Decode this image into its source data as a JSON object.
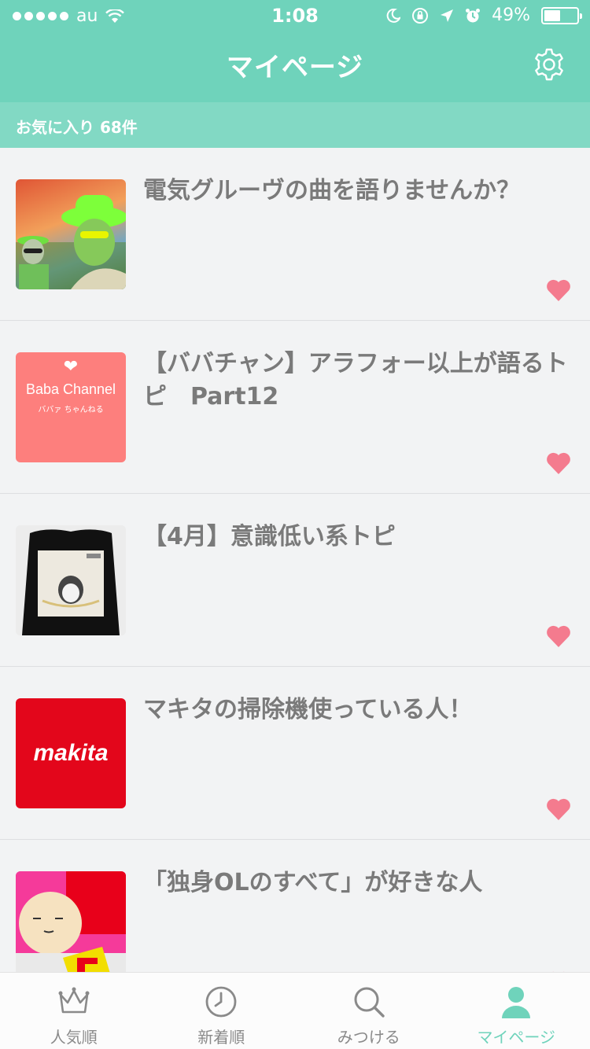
{
  "status_bar": {
    "carrier": "au",
    "time": "1:08",
    "battery_text": "49%",
    "battery_level": 0.49
  },
  "header": {
    "title": "マイページ",
    "settings_icon": "gear-icon"
  },
  "favorites": {
    "label": "お気に入り 68件"
  },
  "items": [
    {
      "title": "電気グルーヴの曲を語りませんか？",
      "favorited": true
    },
    {
      "title": "【ババチャン】アラフォー以上が語るトピ　Part12",
      "favorited": true,
      "thumb": {
        "heart": "❤",
        "name": "Baba Channel",
        "sub": "ババァ ちゃんねる"
      }
    },
    {
      "title": "【4月】意識低い系トピ",
      "favorited": true
    },
    {
      "title": "マキタの掃除機使っている人！",
      "favorited": true,
      "thumb": {
        "logo": "makita"
      }
    },
    {
      "title": "「独身OLのすべて」が好きな人",
      "favorited": true
    }
  ],
  "tabs": [
    {
      "label": "人気順",
      "icon": "crown-icon",
      "active": false
    },
    {
      "label": "新着順",
      "icon": "clock-icon",
      "active": false
    },
    {
      "label": "みつける",
      "icon": "search-icon",
      "active": false
    },
    {
      "label": "マイページ",
      "icon": "person-icon",
      "active": true
    }
  ],
  "colors": {
    "accent": "#6fd3bb",
    "subbar": "#82d9c4",
    "heart": "#f47b8e",
    "title_text": "#7a7a7a"
  }
}
